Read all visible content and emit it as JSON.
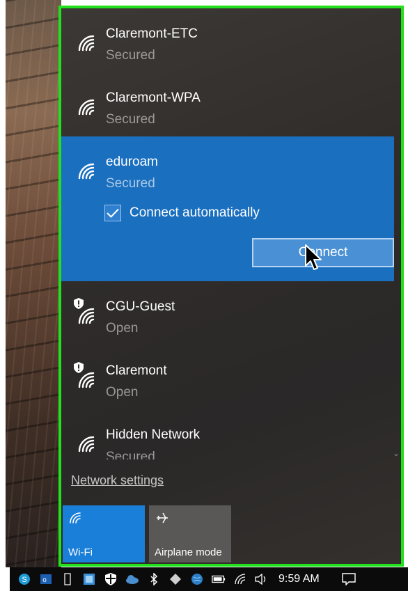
{
  "networks": [
    {
      "name": "Claremont-ETC",
      "status": "Secured"
    },
    {
      "name": "Claremont-WPA",
      "status": "Secured"
    },
    {
      "name": "eduroam",
      "status": "Secured"
    },
    {
      "name": "CGU-Guest",
      "status": "Open"
    },
    {
      "name": "Claremont",
      "status": "Open"
    },
    {
      "name": "Hidden Network",
      "status": "Secured"
    }
  ],
  "selected": {
    "auto_connect_label": "Connect automatically",
    "auto_connect_checked": true,
    "connect_label": "Connect"
  },
  "footer": {
    "network_settings": "Network settings"
  },
  "tiles": {
    "wifi_label": "Wi-Fi",
    "airplane_label": "Airplane mode"
  },
  "taskbar": {
    "time": "9:59 AM"
  },
  "colors": {
    "accent": "#1a6fbf",
    "tile_active": "#1a7fd8",
    "highlight_border": "#22e01c"
  }
}
